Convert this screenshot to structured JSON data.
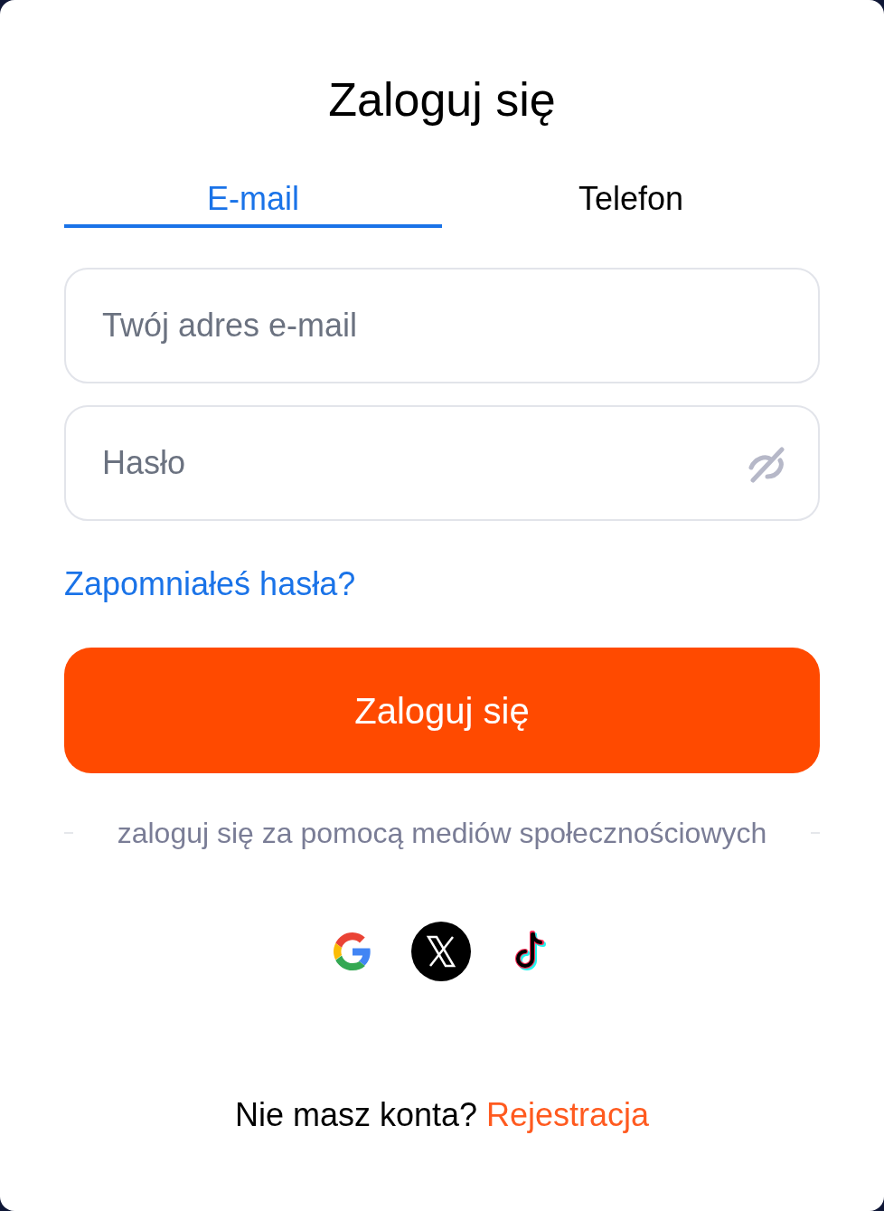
{
  "title": "Zaloguj się",
  "tabs": [
    {
      "label": "E-mail",
      "selected": true
    },
    {
      "label": "Telefon",
      "selected": false
    }
  ],
  "fields": [
    {
      "kind": "text",
      "placeholder": "Twój adres e-mail"
    },
    {
      "kind": "password",
      "placeholder": "Hasło"
    }
  ],
  "forgot_link": "Zapomniałeś hasła?",
  "submit_button": "Zaloguj się",
  "social_divider": "zaloguj się za pomocą mediów społecznościowych",
  "signup": {
    "prompt": "Nie masz konta?",
    "link": "Rejestracja"
  }
}
